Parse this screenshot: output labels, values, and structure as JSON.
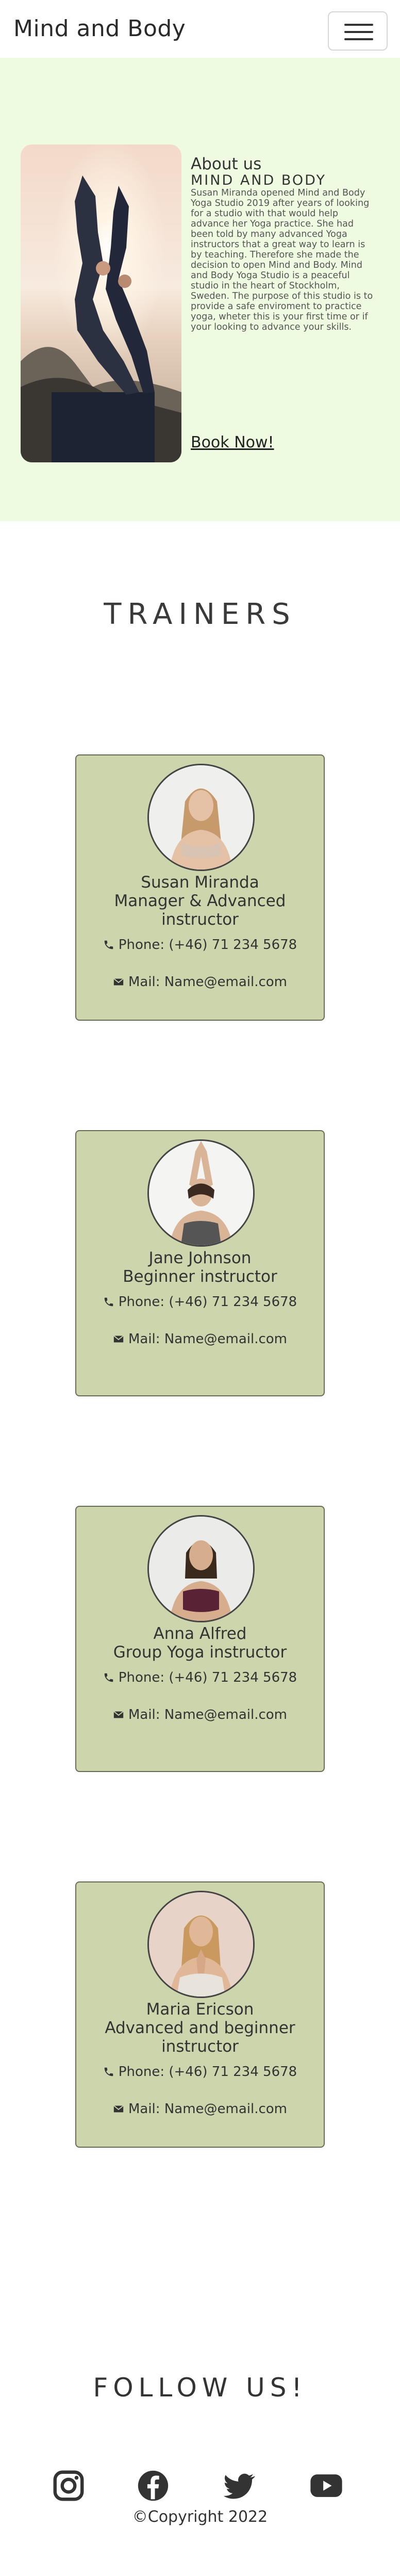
{
  "header": {
    "brand": "Mind and Body",
    "menu_icon": "hamburger-menu-icon"
  },
  "about": {
    "title": "About us",
    "subtitle": "MIND AND BODY",
    "text": "Susan Miranda opened Mind and Body Yoga Studio 2019 after years of looking for a studio with that would help advance her Yoga practice. She had been told by many advanced Yoga instructors that a great way to learn is by teaching. Therefore she made the decision to open Mind and Body. Mind and Body Yoga Studio is a peaceful studio in the heart of Stockholm, Sweden. The purpose of this studio is to provide a safe enviroment to practice yoga, wheter this is your first time or if your looking to advance your skills.",
    "cta": "Book Now!"
  },
  "trainers": {
    "heading": "TRAINERS",
    "items": [
      {
        "name": "Susan Miranda",
        "role_line1": "Manager & Advanced",
        "role_line2": "instructor",
        "phone": "Phone: (+46) 71 234 5678",
        "mail": "Mail: Name@email.com"
      },
      {
        "name": "Jane Johnson",
        "role_line1": "Beginner instructor",
        "role_line2": "",
        "phone": "Phone: (+46) 71 234 5678",
        "mail": "Mail: Name@email.com"
      },
      {
        "name": "Anna Alfred",
        "role_line1": "Group Yoga instructor",
        "role_line2": "",
        "phone": "Phone: (+46) 71 234 5678",
        "mail": "Mail: Name@email.com"
      },
      {
        "name": "Maria Ericson",
        "role_line1": "Advanced and beginner",
        "role_line2": "instructor",
        "phone": "Phone: (+46) 71 234 5678",
        "mail": "Mail: Name@email.com"
      }
    ]
  },
  "follow": {
    "heading": "FOLLOW US!",
    "icons": [
      "instagram-icon",
      "facebook-icon",
      "twitter-icon",
      "youtube-icon"
    ]
  },
  "footer": {
    "copyright": "©Copyright 2022"
  },
  "colors": {
    "about_bg": "#eefbe0",
    "card_bg": "#cdd5ac",
    "text": "#333333"
  }
}
